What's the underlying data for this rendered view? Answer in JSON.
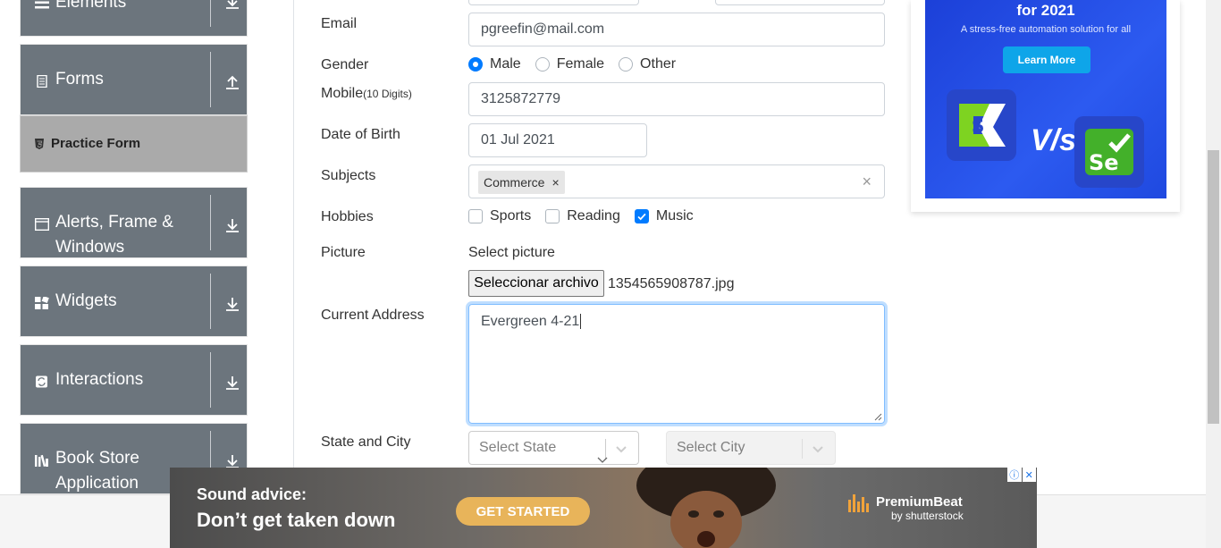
{
  "sidebar": {
    "groups": [
      {
        "label": "Elements",
        "icon": "hamburger-icon",
        "arrow": "download-arrow-icon"
      },
      {
        "label": "Forms",
        "icon": "document-icon",
        "arrow": "upload-arrow-icon"
      },
      {
        "label": "Alerts, Frame & Windows",
        "icon": "window-icon",
        "arrow": "download-arrow-icon"
      },
      {
        "label": "Widgets",
        "icon": "widgets-icon",
        "arrow": "download-arrow-icon"
      },
      {
        "label": "Interactions",
        "icon": "interactions-icon",
        "arrow": "download-arrow-icon"
      },
      {
        "label": "Book Store Application",
        "icon": "library-icon",
        "arrow": "download-arrow-icon"
      }
    ],
    "active_item": {
      "label": "Practice Form",
      "icon": "html5-icon"
    }
  },
  "form": {
    "email": {
      "label": "Email",
      "value": "pgreefin@mail.com"
    },
    "gender": {
      "label": "Gender",
      "options": [
        "Male",
        "Female",
        "Other"
      ],
      "selected": "Male"
    },
    "mobile": {
      "label": "Mobile",
      "hint": "(10 Digits)",
      "value": "3125872779"
    },
    "dob": {
      "label": "Date of Birth",
      "value": "01 Jul 2021"
    },
    "subjects": {
      "label": "Subjects",
      "chips": [
        "Commerce"
      ],
      "chip_remove": "×",
      "clear": "×"
    },
    "hobbies": {
      "label": "Hobbies",
      "options": [
        "Sports",
        "Reading",
        "Music"
      ],
      "checked": [
        "Music"
      ]
    },
    "picture": {
      "label": "Picture",
      "caption": "Select picture",
      "button": "Seleccionar archivo",
      "file": "1354565908787.jpg"
    },
    "address": {
      "label": "Current Address",
      "value": "Evergreen 4-21"
    },
    "state_city": {
      "label": "State and City",
      "state_placeholder": "Select State",
      "city_placeholder": "Select City"
    }
  },
  "ad": {
    "title": "for 2021",
    "subtitle": "A stress-free automation solution for all",
    "button": "Learn More",
    "vs": "V/s"
  },
  "banner": {
    "line1": "Sound advice:",
    "line2": "Don’t get taken down",
    "button": "GET STARTED",
    "brand": "PremiumBeat",
    "brand_sub": "by shutterstock",
    "icons": [
      "adchoices-icon",
      "close-icon"
    ]
  },
  "colors": {
    "accent": "#007bff",
    "sidebar": "#6c757d",
    "active_item": "#aaaaaa",
    "ad_bg": "#2c5af0",
    "banner_button": "#e8b45a"
  }
}
